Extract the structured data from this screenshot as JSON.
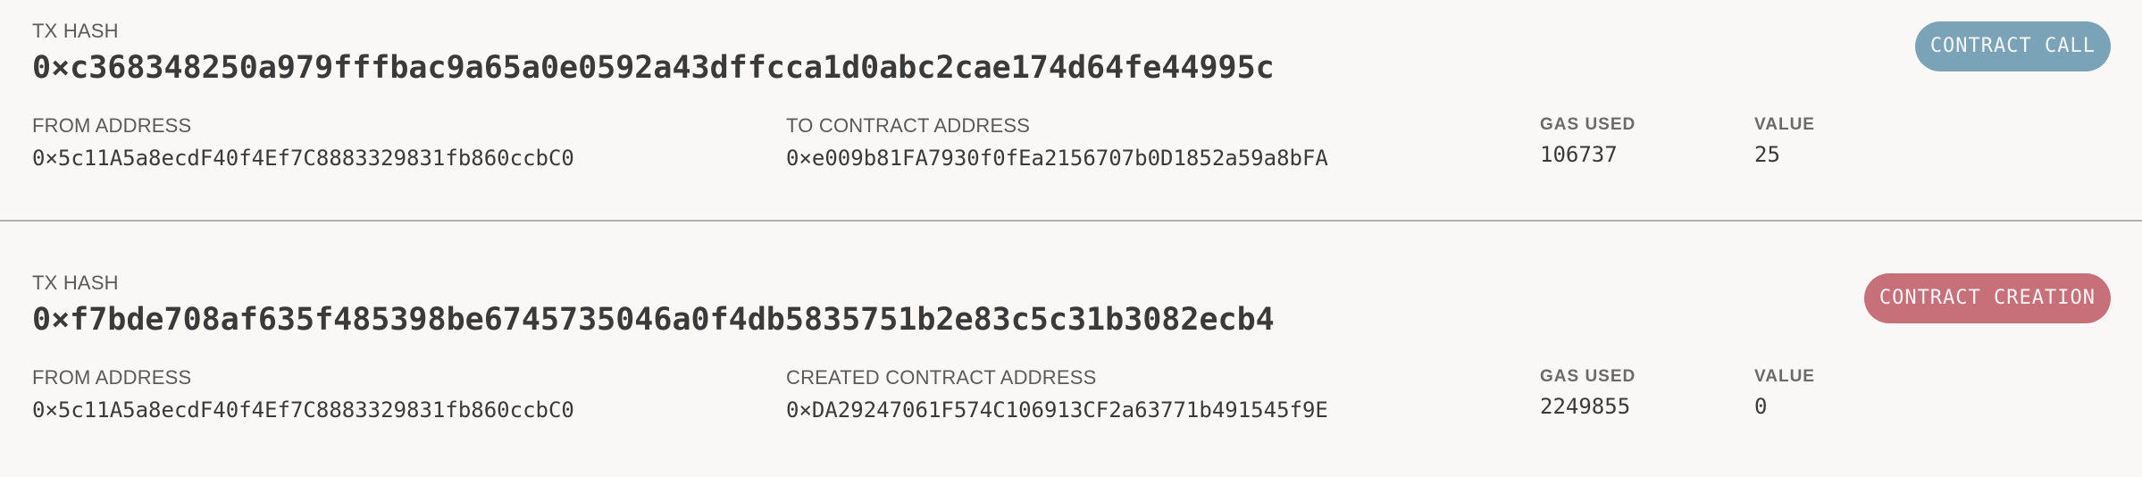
{
  "transactions": [
    {
      "hash_label": "TX HASH",
      "hash": "0×c368348250a979fffbac9a65a0e0592a43dffcca1d0abc2cae174d64fe44995c",
      "badge": {
        "label": "CONTRACT CALL",
        "color": "#7aa3b8"
      },
      "from_label": "FROM ADDRESS",
      "from": "0×5c11A5a8ecdF40f4Ef7C8883329831fb860ccbC0",
      "to_label": "TO CONTRACT ADDRESS",
      "to": "0×e009b81FA7930f0fEa2156707b0D1852a59a8bFA",
      "gas_label": "GAS USED",
      "gas": "106737",
      "value_label": "VALUE",
      "value": "25"
    },
    {
      "hash_label": "TX HASH",
      "hash": "0×f7bde708af635f485398be6745735046a0f4db5835751b2e83c5c31b3082ecb4",
      "badge": {
        "label": "CONTRACT CREATION",
        "color": "#c7707a"
      },
      "from_label": "FROM ADDRESS",
      "from": "0×5c11A5a8ecdF40f4Ef7C8883329831fb860ccbC0",
      "to_label": "CREATED CONTRACT ADDRESS",
      "to": "0×DA29247061F574C106913CF2a63771b491545f9E",
      "gas_label": "GAS USED",
      "gas": "2249855",
      "value_label": "VALUE",
      "value": "0"
    }
  ]
}
